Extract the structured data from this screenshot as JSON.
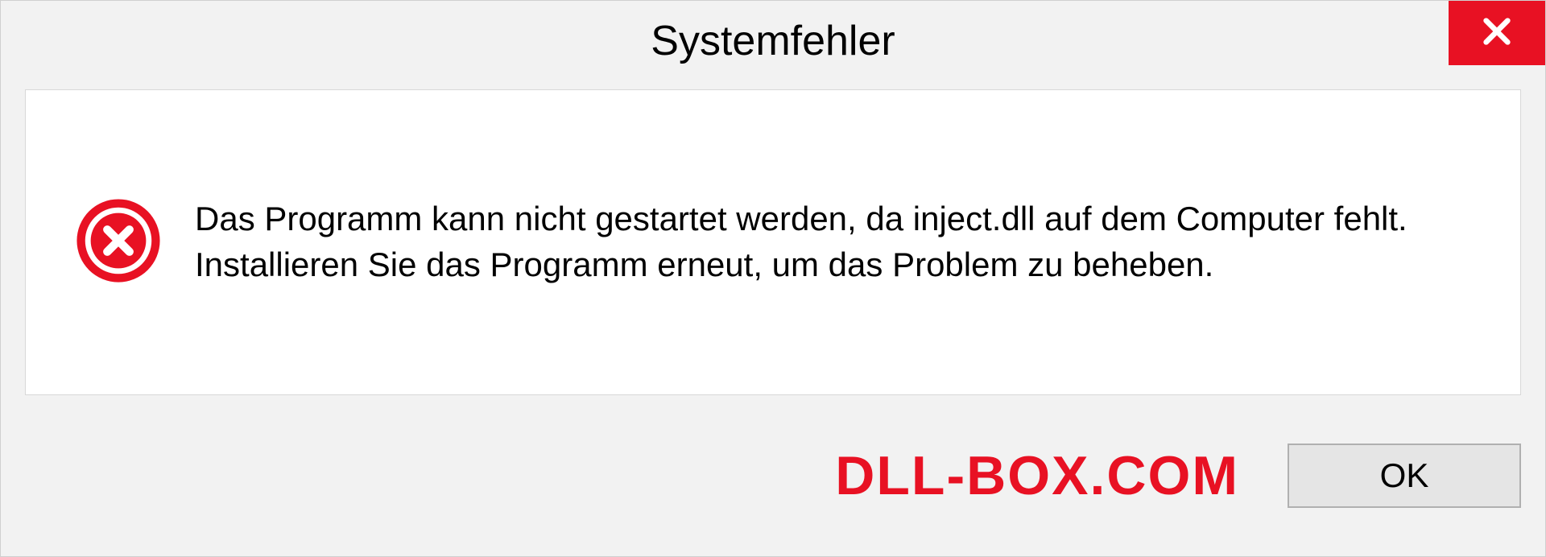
{
  "dialog": {
    "title": "Systemfehler",
    "message": "Das Programm kann nicht gestartet werden, da inject.dll auf dem Computer fehlt. Installieren Sie das Programm erneut, um das Problem zu beheben.",
    "ok_label": "OK"
  },
  "watermark": "DLL-BOX.COM",
  "colors": {
    "close_red": "#e81123",
    "watermark_red": "#e81123"
  }
}
